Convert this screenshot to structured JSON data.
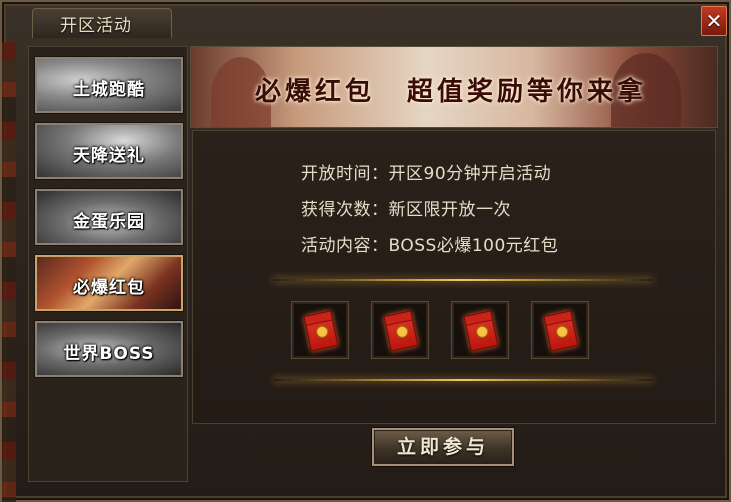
{
  "window": {
    "title": "开区活动",
    "close_label": "✕"
  },
  "sidebar": {
    "items": [
      {
        "label": "土城跑酷",
        "active": false
      },
      {
        "label": "天降送礼",
        "active": false
      },
      {
        "label": "金蛋乐园",
        "active": false
      },
      {
        "label": "必爆红包",
        "active": true
      },
      {
        "label": "世界BOSS",
        "active": false
      }
    ]
  },
  "banner": {
    "left_text": "必爆红包",
    "right_text": "超值奖励等你来拿"
  },
  "info": {
    "lines": [
      {
        "key": "开放时间：",
        "value": "开区90分钟开启活动"
      },
      {
        "key": "获得次数：",
        "value": "新区限开放一次"
      },
      {
        "key": "活动内容：",
        "value": "BOSS必爆100元红包"
      }
    ]
  },
  "rewards": [
    {
      "icon": "red-envelope-icon"
    },
    {
      "icon": "red-envelope-icon"
    },
    {
      "icon": "red-envelope-icon"
    },
    {
      "icon": "red-envelope-icon"
    }
  ],
  "actions": {
    "join_label": "立即参与"
  },
  "colors": {
    "accent_gold": "#f0c862",
    "close_red": "#c03a22",
    "text": "#e7dcc8"
  }
}
